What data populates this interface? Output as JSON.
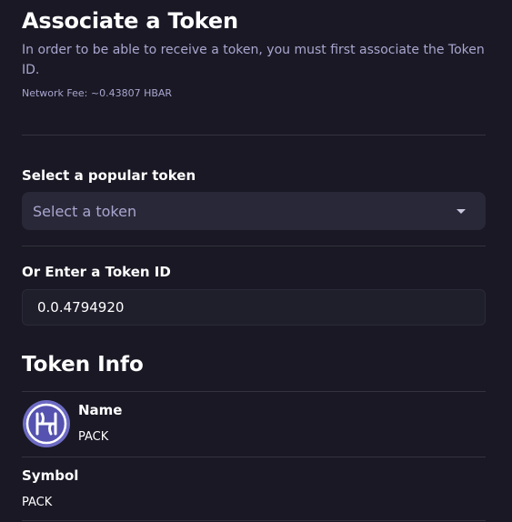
{
  "header": {
    "title": "Associate a Token",
    "description": "In order to be able to receive a token, you must first associate the Token ID.",
    "network_fee": "Network Fee: ~0.43807 HBAR"
  },
  "popular": {
    "label": "Select a popular token",
    "placeholder": "Select a token"
  },
  "manual": {
    "label": "Or Enter a Token ID",
    "value": "0.0.4794920"
  },
  "token_info": {
    "title": "Token Info",
    "icon": "pack-logo-icon",
    "name_label": "Name",
    "name_value": "PACK",
    "symbol_label": "Symbol",
    "symbol_value": "PACK"
  },
  "colors": {
    "background": "#191824",
    "muted_text": "#a9a6cf",
    "select_bg": "#292838",
    "logo_ring": "#6d6bc4"
  }
}
